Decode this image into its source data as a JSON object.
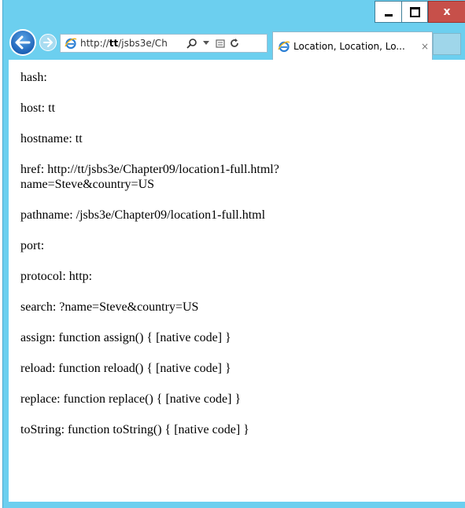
{
  "window": {
    "close_label": "x"
  },
  "navigation": {
    "address_prefix": "http://",
    "address_host": "tt",
    "address_rest": "/jsbs3e/Ch",
    "tab_title": "Location, Location, Lo...",
    "tab_close": "×"
  },
  "content": {
    "lines": [
      "hash:",
      "host: tt",
      "hostname: tt",
      "href: http://tt/jsbs3e/Chapter09/location1-full.html?\nname=Steve&country=US",
      "pathname: /jsbs3e/Chapter09/location1-full.html",
      "port:",
      "protocol: http:",
      "search: ?name=Steve&country=US",
      "assign: function assign() { [native code] }",
      "reload: function reload() { [native code] }",
      "replace: function replace() { [native code] }",
      "toString: function toString() { [native code] }"
    ]
  }
}
